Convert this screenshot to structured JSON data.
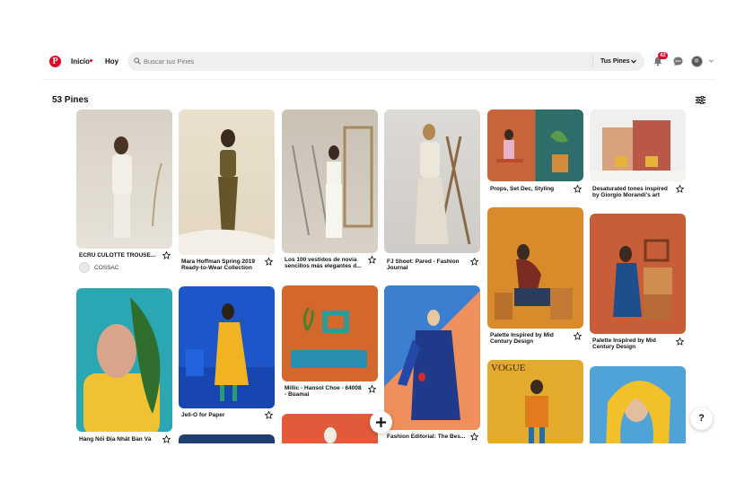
{
  "header": {
    "nav": [
      {
        "label": "Inicio"
      },
      {
        "label": "Hoy"
      }
    ],
    "search_placeholder": "Buscar tus Pines",
    "scope_label": "Tus Pines",
    "notification_count": "42"
  },
  "board": {
    "pin_count_label": "53 Pines"
  },
  "pins": [
    {
      "title": "ECRU CULOTTE TROUSE...",
      "source": "COSSAC",
      "img": "#d9d3c8"
    },
    {
      "title": "Mara Hoffman Spring 2019 Ready-to-Wear Collection",
      "img": "#e7ddc9"
    },
    {
      "title": "Los 100 vestidos de novia sencillos más elegantes d...",
      "img": "#cfc6b9"
    },
    {
      "title": "FJ Shoot: Pared - Fashion Journal",
      "img": "#d6d3ce"
    },
    {
      "title": "Props, Set Dec, Styling",
      "img": "#c4623a"
    },
    {
      "title": "Desaturated tones inspired by Giorgio Morandi's art",
      "img": "#d7b8a3"
    },
    {
      "title": "Hàng Nổi Địa Nhất Bản Và",
      "img": "#2aa7b5"
    },
    {
      "title": "Jell-O for Paper",
      "img": "#1f57c7"
    },
    {
      "title": "Millic - Hansol Choe - 64008 - Buamai",
      "img": "#d5682c"
    },
    {
      "title": "Fashion Editorial: The Bes...",
      "img": "#e98a55"
    },
    {
      "title": "Palette Inspired by Mid Century Design",
      "img": "#d98a2a"
    },
    {
      "title": "Palette Inspired by Mid Century Design",
      "img": "#c85e38"
    },
    {
      "title": "",
      "img": "#e4aa2b",
      "overlay": "VOGUE"
    },
    {
      "title": "",
      "img": "#4fa3d6"
    },
    {
      "title": "",
      "img": "#1f3d6e"
    },
    {
      "title": "",
      "img": "#e35a3b"
    }
  ],
  "colors": {
    "brand": "#e60023",
    "search_bg": "#efefef"
  },
  "icons": [
    "pinterest-logo-icon",
    "search-icon",
    "chevron-down-icon",
    "bell-icon",
    "chat-icon",
    "filter-icon",
    "star-icon",
    "plus-icon",
    "help-icon"
  ]
}
